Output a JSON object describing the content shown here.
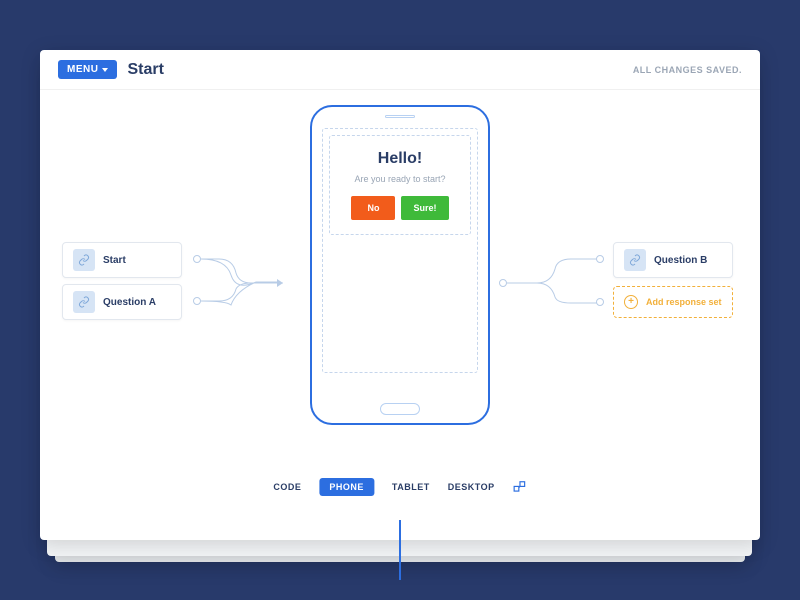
{
  "header": {
    "menu_label": "MENU",
    "page_title": "Start",
    "status": "ALL CHANGES SAVED."
  },
  "preview": {
    "heading": "Hello!",
    "subtext": "Are you ready to start?",
    "no_label": "No",
    "yes_label": "Sure!"
  },
  "left_nodes": [
    {
      "label": "Start"
    },
    {
      "label": "Question A"
    }
  ],
  "right_nodes": [
    {
      "label": "Question B"
    }
  ],
  "add_response_label": "Add response set",
  "tabs": {
    "code": "CODE",
    "phone": "PHONE",
    "tablet": "TABLET",
    "desktop": "DESKTOP"
  }
}
